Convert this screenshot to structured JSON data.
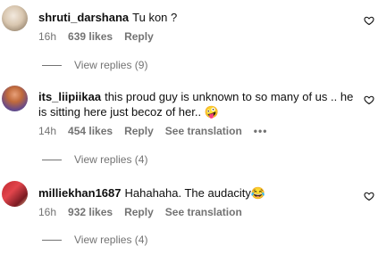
{
  "comments": [
    {
      "username": "shruti_darshana",
      "text": "Tu kon ?",
      "time": "16h",
      "likes": "639 likes",
      "reply": "Reply",
      "view_replies": "View replies (9)"
    },
    {
      "username": "its_liipiikaa",
      "text": "this proud guy is unknown to so many of us .. he is sitting here just becoz of her.. 🤪",
      "time": "14h",
      "likes": "454 likes",
      "reply": "Reply",
      "translation": "See translation",
      "more": "•••",
      "view_replies": "View replies (4)"
    },
    {
      "username": "milliekhan1687",
      "text": "Hahahaha. The audacity😂",
      "time": "16h",
      "likes": "932 likes",
      "reply": "Reply",
      "translation": "See translation",
      "view_replies": "View replies (4)"
    }
  ],
  "icons": {
    "like": "heart-outline-icon"
  },
  "colors": {
    "secondary_text": "#737373"
  }
}
